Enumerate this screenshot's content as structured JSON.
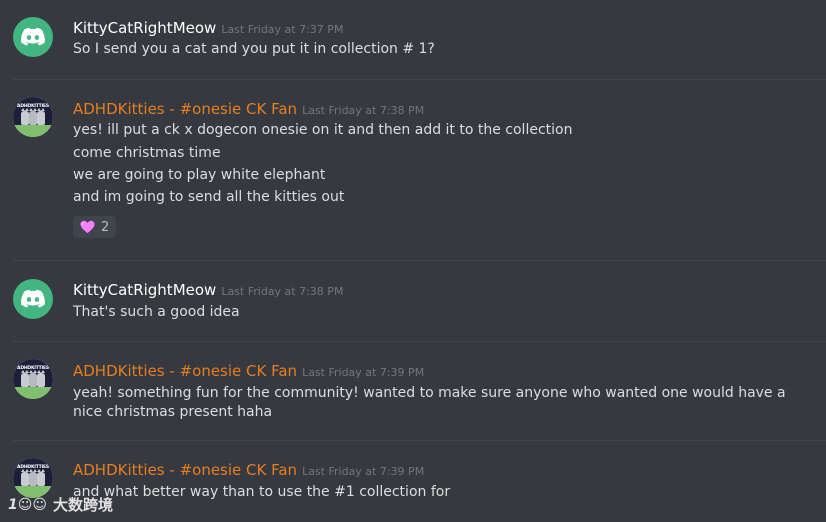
{
  "messages": [
    {
      "username": "KittyCatRightMeow",
      "timestamp": "Last Friday at 7:37 PM",
      "avatar": "discord-logo-icon",
      "lines": [
        "So I send you a cat and you put it in collection # 1?"
      ]
    },
    {
      "username": "ADHDKitties - #onesie CK Fan",
      "timestamp": "Last Friday at 7:38 PM",
      "avatar": "adhdkitties-avatar",
      "avatar_text": "ADHDKITTIES",
      "lines": [
        "yes! ill put a ck x dogecon onesie on it and then add it to the collection",
        "come christmas time",
        "we are going to play white elephant",
        "and im going to send all the kitties out"
      ],
      "reaction": {
        "icon": "pink-heart-icon",
        "count": "2"
      }
    },
    {
      "username": "KittyCatRightMeow",
      "timestamp": "Last Friday at 7:38 PM",
      "avatar": "discord-logo-icon",
      "lines": [
        "That's such a good idea"
      ]
    },
    {
      "username": "ADHDKitties - #onesie CK Fan",
      "timestamp": "Last Friday at 7:39 PM",
      "avatar": "adhdkitties-avatar",
      "avatar_text": "ADHDKITTIES",
      "lines": [
        "yeah! something fun for the community! wanted to make sure anyone who wanted one would have a nice christmas present haha"
      ]
    },
    {
      "username": "ADHDKitties - #onesie CK Fan",
      "timestamp": "Last Friday at 7:39 PM",
      "avatar": "adhdkitties-avatar",
      "avatar_text": "ADHDKITTIES",
      "lines": [
        "and what better way than to use the #1 collection for"
      ]
    }
  ],
  "watermark": {
    "logo": "1☺☺",
    "text": "大数跨境"
  },
  "colors": {
    "background": "#36393f",
    "username_default": "#ffffff",
    "username_orange": "#e67e22",
    "message_text": "#dcddde",
    "timestamp": "#72767d",
    "discord_green": "#43b581",
    "reaction_bg": "#40444b",
    "divider": "#42454a"
  }
}
